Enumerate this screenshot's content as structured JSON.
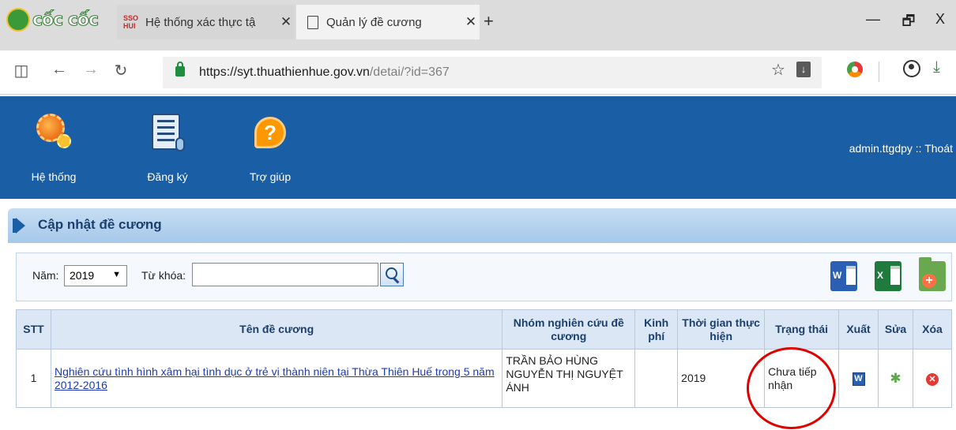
{
  "browser": {
    "logo_text": "cốc cốc",
    "tabs": [
      {
        "favicon": "SSO HUI",
        "title": "Hệ thống xác thực tậ"
      },
      {
        "title": "Quản lý đề cương"
      }
    ],
    "new_tab": "+",
    "window": {
      "minimize": "—",
      "restore": "🗗",
      "close": "X"
    },
    "url_host": "https://syt.thuathienhue.gov.vn",
    "url_path": "/detai/?id=367"
  },
  "header": {
    "menu": [
      {
        "label": "Hệ thống",
        "icon": "gear-icon"
      },
      {
        "label": "Đăng ký",
        "icon": "form-icon"
      },
      {
        "label": "Trợ giúp",
        "icon": "help-icon"
      }
    ],
    "user": "admin.ttgdpy :: Thoát"
  },
  "panel": {
    "title": "Cập nhật đề cương"
  },
  "filter": {
    "year_label": "Năm:",
    "year_value": "2019",
    "keyword_label": "Từ khóa:",
    "keyword_value": ""
  },
  "table": {
    "headers": [
      "STT",
      "Tên đề cương",
      "Nhóm nghiên cứu đề cương",
      "Kinh phí",
      "Thời gian thực hiện",
      "Trạng thái",
      "Xuất",
      "Sửa",
      "Xóa"
    ],
    "rows": [
      {
        "stt": "1",
        "title": "Nghiên cứu tình hình xâm hại tình dục ở trẻ vị thành niên tại Thừa Thiên Huế trong 5 năm 2012-2016",
        "group": "TRẦN BẢO HÙNG NGUYỄN THỊ NGUYỆT ÁNH",
        "budget": "",
        "time": "2019",
        "status": "Chưa tiếp nhận"
      }
    ]
  }
}
